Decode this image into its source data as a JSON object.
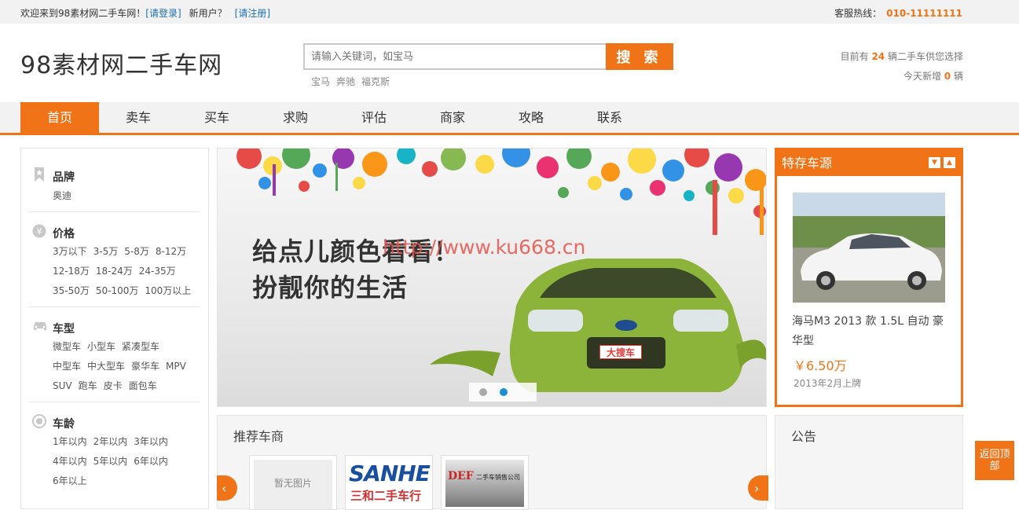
{
  "topbar": {
    "welcome": "欢迎来到98素材网二手车网！",
    "login": "[请登录]",
    "new_user": "新用户？",
    "register": "[请注册]",
    "hotline_label": "客服热线：",
    "hotline": "010-11111111"
  },
  "header": {
    "logo": "98素材网二手车网",
    "search_placeholder": "请输入关键词，如宝马",
    "search_button": "搜 索",
    "hot_tags": [
      "宝马",
      "奔驰",
      "福克斯"
    ],
    "stats_prefix": "目前有",
    "stats_count": "24",
    "stats_suffix": "辆二手车供您选择",
    "today_prefix": "今天新增",
    "today_count": "0",
    "today_suffix": "辆"
  },
  "nav": [
    "首页",
    "卖车",
    "买车",
    "求购",
    "评估",
    "商家",
    "攻略",
    "联系"
  ],
  "filters": {
    "brand": {
      "title": "品牌",
      "rows": [
        [
          "奥迪"
        ]
      ]
    },
    "price": {
      "title": "价格",
      "rows": [
        [
          "3万以下",
          "3-5万",
          "5-8万",
          "8-12万"
        ],
        [
          "12-18万",
          "18-24万",
          "24-35万"
        ],
        [
          "35-50万",
          "50-100万",
          "100万以上"
        ]
      ]
    },
    "type": {
      "title": "车型",
      "rows": [
        [
          "微型车",
          "小型车",
          "紧凑型车"
        ],
        [
          "中型车",
          "中大型车",
          "豪华车",
          "MPV"
        ],
        [
          "SUV",
          "跑车",
          "皮卡",
          "面包车"
        ]
      ]
    },
    "age": {
      "title": "车龄",
      "rows": [
        [
          "1年以内",
          "2年以内",
          "3年以内"
        ],
        [
          "4年以内",
          "5年以内",
          "6年以内"
        ],
        [
          "6年以上"
        ]
      ]
    }
  },
  "banner": {
    "line1": "给点儿颜色看看！",
    "line2": "扮靓你的生活",
    "watermark": "http://www.ku668.cn",
    "car_badge": "大搜车"
  },
  "featured": {
    "title": "特存车源",
    "car_name": "海马M3 2013 款 1.5L 自动 豪华型",
    "price": "￥6.50万",
    "date": "2013年2月上牌"
  },
  "dealers": {
    "title": "推荐车商",
    "no_image": "暂无图片",
    "logo1": "SANHE",
    "logo1_sub": "三和二手车行",
    "logo2": "DEF",
    "logo2_sub": "二手车销售公司"
  },
  "notice": {
    "title": "公告"
  },
  "back_to_top": "返回顶部",
  "colors": {
    "accent": "#f07417",
    "link": "#1a6fb5"
  }
}
